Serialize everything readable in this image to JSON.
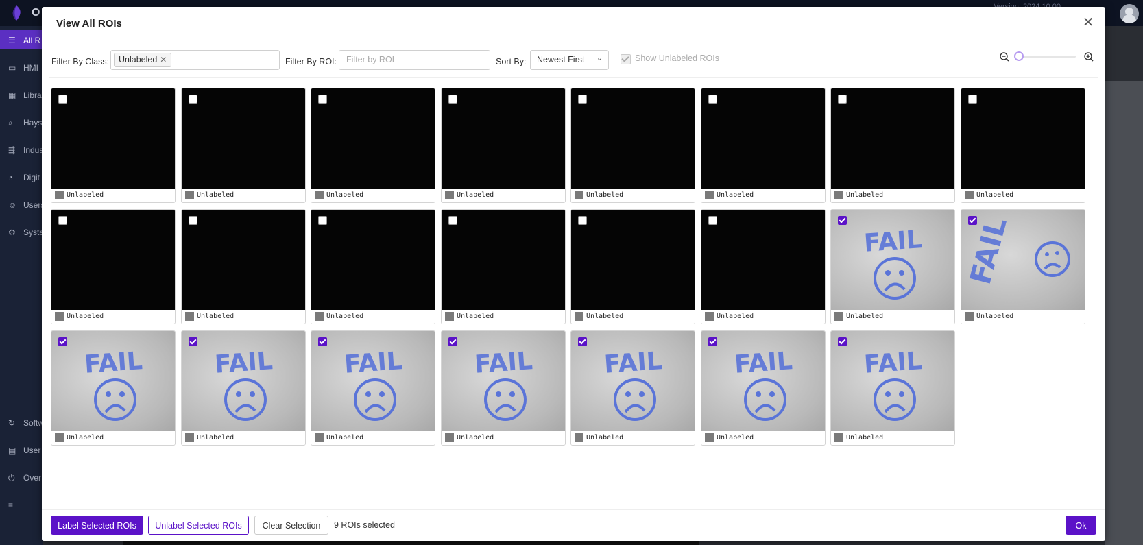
{
  "app": {
    "brand": "O",
    "version": "Version: 2024.10.00"
  },
  "sidebar": {
    "items": [
      {
        "label": "All R",
        "icon": "list-icon",
        "active": true
      },
      {
        "label": "HMI",
        "icon": "video-icon"
      },
      {
        "label": "Libra",
        "icon": "grid-icon"
      },
      {
        "label": "Hays",
        "icon": "search-icon"
      },
      {
        "label": "Indus",
        "icon": "flow-icon"
      },
      {
        "label": "Digit",
        "icon": "g-icon"
      },
      {
        "label": "Users",
        "icon": "user-icon"
      },
      {
        "label": "Syste",
        "icon": "gear-icon"
      },
      {
        "label": "Softw",
        "icon": "refresh-icon"
      },
      {
        "label": "User",
        "icon": "book-icon"
      },
      {
        "label": "Over",
        "icon": "power-icon"
      }
    ]
  },
  "modal": {
    "title": "View All ROIs",
    "filters": {
      "class_label": "Filter By Class:",
      "class_tag": "Unlabeled",
      "roi_label": "Filter By ROI:",
      "roi_placeholder": "Filter by ROI",
      "sort_label": "Sort By:",
      "sort_value": "Newest First",
      "show_unlabeled_label": "Show Unlabeled ROIs",
      "show_unlabeled_checked": true
    },
    "zoom_level": 0,
    "rois": [
      {
        "label": "Unlabeled",
        "selected": false,
        "image": "black"
      },
      {
        "label": "Unlabeled",
        "selected": false,
        "image": "black"
      },
      {
        "label": "Unlabeled",
        "selected": false,
        "image": "black"
      },
      {
        "label": "Unlabeled",
        "selected": false,
        "image": "black"
      },
      {
        "label": "Unlabeled",
        "selected": false,
        "image": "black"
      },
      {
        "label": "Unlabeled",
        "selected": false,
        "image": "black"
      },
      {
        "label": "Unlabeled",
        "selected": false,
        "image": "black"
      },
      {
        "label": "Unlabeled",
        "selected": false,
        "image": "black"
      },
      {
        "label": "Unlabeled",
        "selected": false,
        "image": "black"
      },
      {
        "label": "Unlabeled",
        "selected": false,
        "image": "black"
      },
      {
        "label": "Unlabeled",
        "selected": false,
        "image": "black"
      },
      {
        "label": "Unlabeled",
        "selected": false,
        "image": "black"
      },
      {
        "label": "Unlabeled",
        "selected": false,
        "image": "black"
      },
      {
        "label": "Unlabeled",
        "selected": false,
        "image": "black"
      },
      {
        "label": "Unlabeled",
        "selected": true,
        "image": "fail"
      },
      {
        "label": "Unlabeled",
        "selected": true,
        "image": "fail-rotated"
      },
      {
        "label": "Unlabeled",
        "selected": true,
        "image": "fail"
      },
      {
        "label": "Unlabeled",
        "selected": true,
        "image": "fail"
      },
      {
        "label": "Unlabeled",
        "selected": true,
        "image": "fail"
      },
      {
        "label": "Unlabeled",
        "selected": true,
        "image": "fail"
      },
      {
        "label": "Unlabeled",
        "selected": true,
        "image": "fail"
      },
      {
        "label": "Unlabeled",
        "selected": true,
        "image": "fail"
      },
      {
        "label": "Unlabeled",
        "selected": true,
        "image": "fail"
      }
    ],
    "footer": {
      "label_selected": "Label Selected ROIs",
      "unlabel_selected": "Unlabel Selected ROIs",
      "clear_selection": "Clear Selection",
      "selection_count": "9 ROIs selected",
      "ok": "Ok"
    }
  },
  "colors": {
    "accent": "#5b12c8",
    "sidebar_active": "#5b2fc2",
    "fail_ink": "#5a74d8"
  }
}
